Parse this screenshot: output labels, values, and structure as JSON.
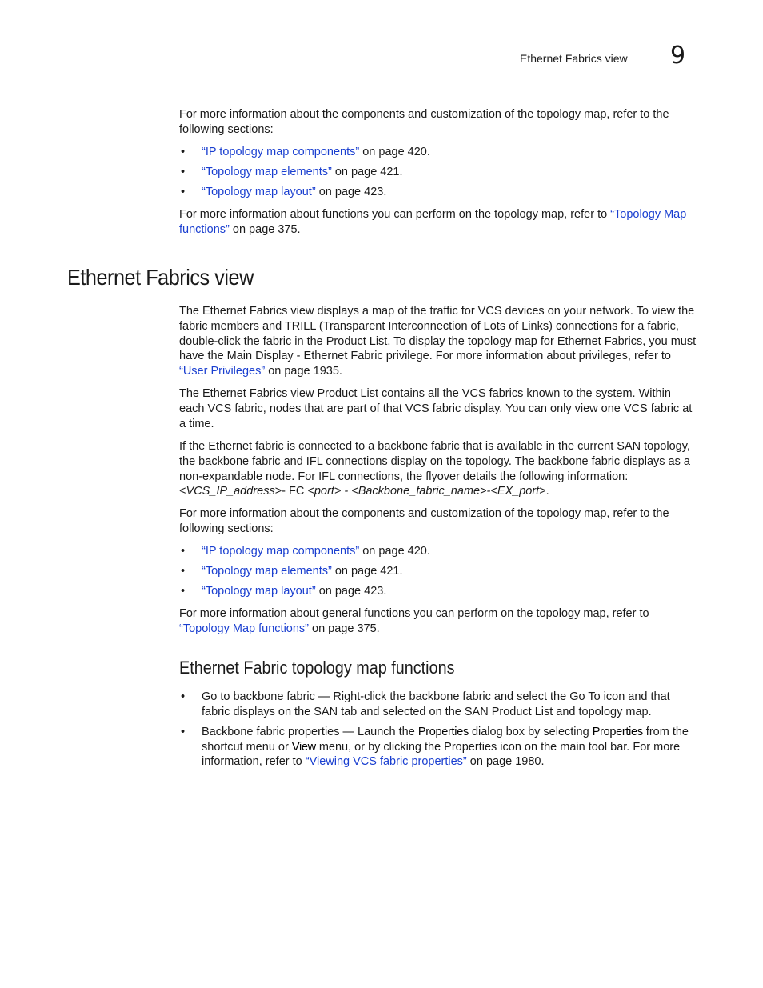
{
  "header": {
    "section_title": "Ethernet Fabrics view",
    "chapter_number": "9"
  },
  "intro": {
    "para1": "For more information about the components and customization of the topology map, refer to the following sections:",
    "bullets": [
      {
        "link": "“IP topology map components”",
        "suffix": " on page 420."
      },
      {
        "link": "“Topology map elements”",
        "suffix": " on page 421."
      },
      {
        "link": "“Topology map layout”",
        "suffix": " on page 423."
      }
    ],
    "para2_prefix": "For more information about functions you can perform on the topology map, refer to ",
    "para2_link": "“Topology Map functions”",
    "para2_suffix": " on page 375."
  },
  "section": {
    "heading": "Ethernet Fabrics view",
    "p1_text": "The Ethernet Fabrics view displays a map of the traffic for VCS devices on your network. To view the fabric members and TRILL (Transparent Interconnection of Lots of Links) connections for a fabric, double-click the fabric in the Product List. To display the topology map for Ethernet Fabrics, you must have the Main Display - Ethernet Fabric privilege. For more information about privileges, refer to ",
    "p1_link": "“User Privileges”",
    "p1_suffix": " on page 1935.",
    "p2": "The Ethernet Fabrics view Product List contains all the VCS fabrics known to the system. Within each VCS fabric, nodes that are part of that VCS fabric display. You can only view one VCS fabric at a time.",
    "p3_text": "If the Ethernet fabric is connected to a backbone fabric that is available in the current SAN topology, the backbone fabric and IFL connections display on the topology. The backbone fabric displays as a non-expandable node. For IFL connections, the flyover details the following information: ",
    "p3_code": {
      "lt1": "<",
      "v1": "VCS_IP_address",
      "gt1": ">- FC ",
      "lt2": "<",
      "v2": "port",
      "gt2": "> - <",
      "v3": "Backbone_fabric_name",
      "gt3": ">-<",
      "v4": "EX_port",
      "gt4": ">."
    },
    "p4": "For more information about the components and customization of the topology map, refer to the following sections:",
    "bullets": [
      {
        "link": "“IP topology map components”",
        "suffix": " on page 420."
      },
      {
        "link": "“Topology map elements”",
        "suffix": " on page 421."
      },
      {
        "link": "“Topology map layout”",
        "suffix": " on page 423."
      }
    ],
    "p5_prefix": "For more information about general functions you can perform on the topology map, refer to ",
    "p5_link": "“Topology Map functions”",
    "p5_suffix": " on page 375."
  },
  "subsection": {
    "heading": "Ethernet Fabric topology map functions",
    "item1": "Go to backbone fabric — Right-click the backbone fabric and select the Go To icon and that fabric displays on the SAN tab and selected on the SAN Product List and topology map.",
    "item2": {
      "t1": "Backbone fabric properties — Launch the ",
      "b1": "Properties",
      "t2": " dialog box by selecting ",
      "b2": "Properties",
      "t3": " from the shortcut menu or ",
      "b3": "View",
      "t4": " menu, or by clicking the Properties icon on the main tool bar. For more information, refer to ",
      "link": "“Viewing VCS fabric properties”",
      "t5": " on page 1980."
    },
    "bullet_glyph": "•"
  }
}
